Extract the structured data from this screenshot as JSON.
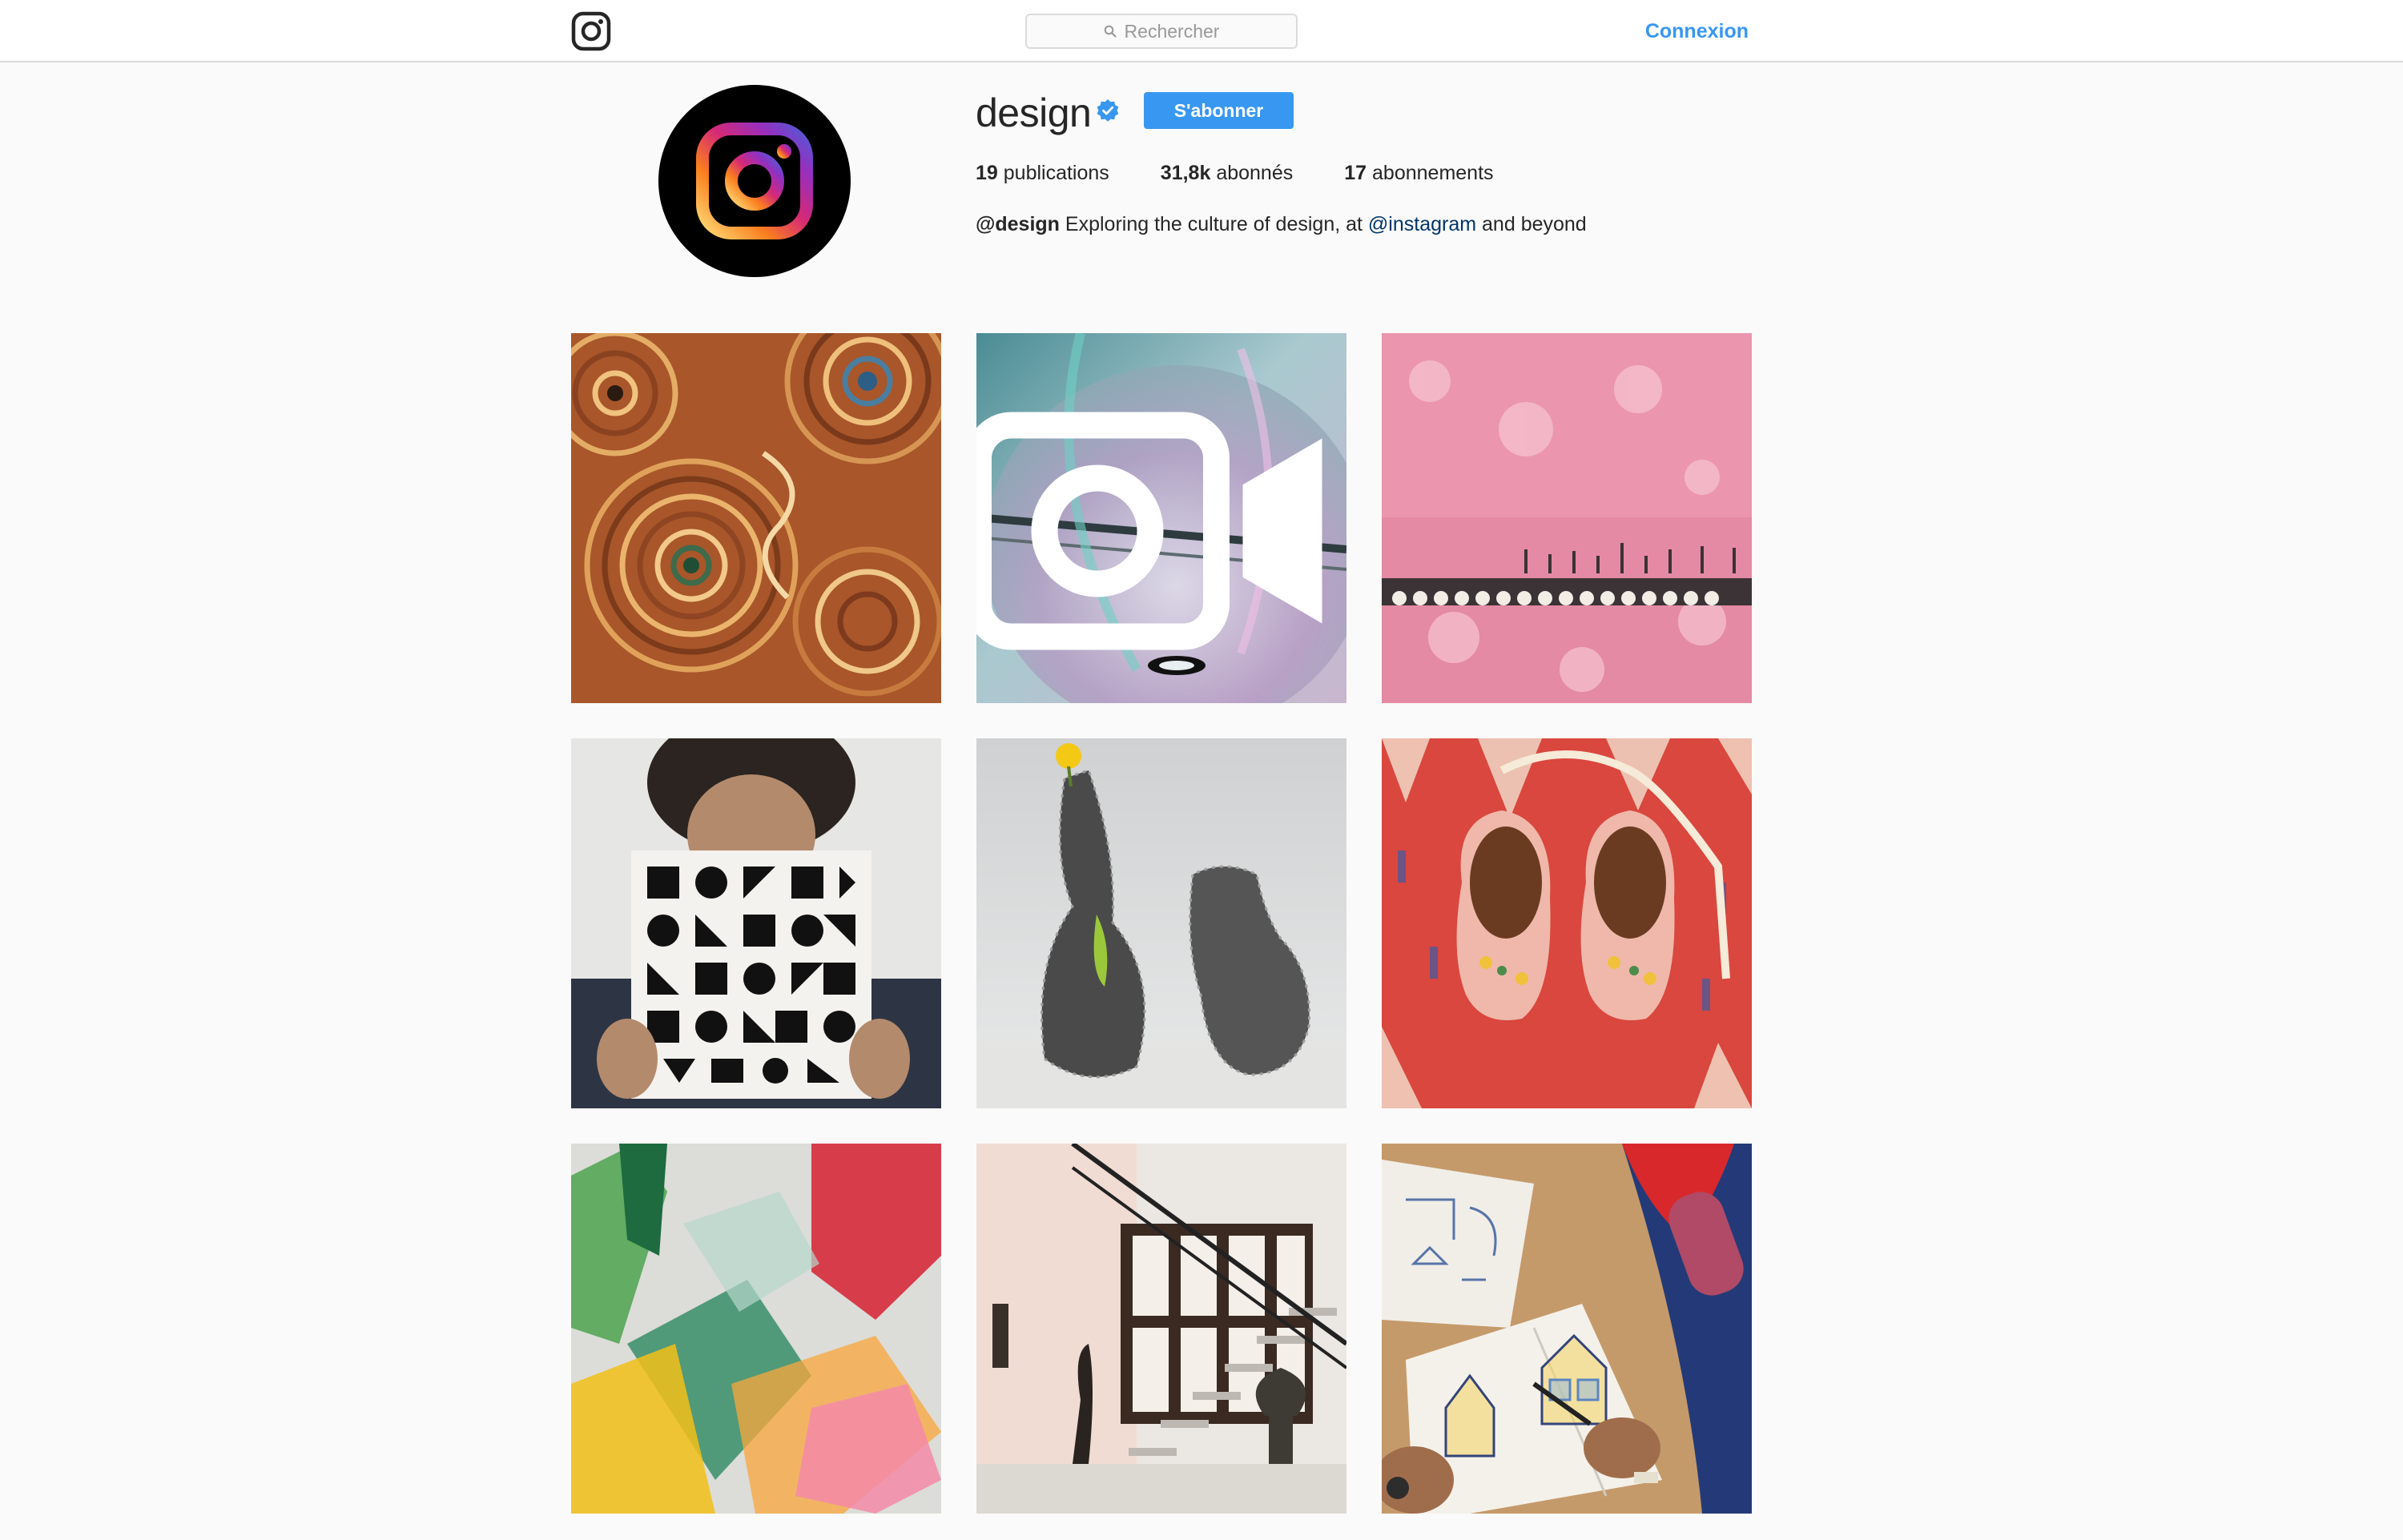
{
  "header": {
    "search_placeholder": "Rechercher",
    "login_label": "Connexion"
  },
  "profile": {
    "username": "design",
    "follow_label": "S'abonner",
    "stats": {
      "posts_count": "19",
      "posts_label": "publications",
      "followers_count": "31,8k",
      "followers_label": "abonnés",
      "following_count": "17",
      "following_label": "abonnements"
    },
    "bio": {
      "handle": "@design",
      "text_before": "Exploring the culture of design, at",
      "mention": "@instagram",
      "text_after": "and beyond"
    }
  },
  "posts": [
    {
      "kind": "image",
      "icon": "aboriginal-dot-painting"
    },
    {
      "kind": "video",
      "icon": "iridescent-glass-bubble"
    },
    {
      "kind": "image",
      "icon": "pink-textile-panel"
    },
    {
      "kind": "image",
      "icon": "person-holding-pattern-book"
    },
    {
      "kind": "image",
      "icon": "wire-vase-sculptures"
    },
    {
      "kind": "image",
      "icon": "embroidered-baby-shoes"
    },
    {
      "kind": "image",
      "icon": "colored-acrylic-forms"
    },
    {
      "kind": "image",
      "icon": "floating-staircase"
    },
    {
      "kind": "image",
      "icon": "sketchbook-drawing"
    }
  ],
  "colors": {
    "accent": "#3897f0",
    "link": "#003569",
    "background": "#fafafa",
    "border": "#dbdbdb"
  }
}
